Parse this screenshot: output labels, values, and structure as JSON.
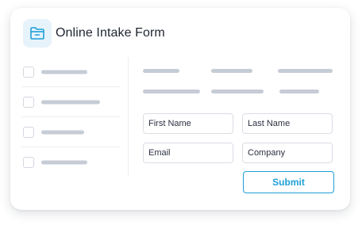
{
  "form": {
    "title": "Online Intake Form",
    "icon": "folder-icon",
    "accent_color": "#1e9fd9",
    "fields": {
      "first_name": "First Name",
      "last_name": "Last Name",
      "email": "Email",
      "company": "Company"
    },
    "submit_label": "Submit"
  },
  "sidebar": {
    "item_count": 4
  }
}
